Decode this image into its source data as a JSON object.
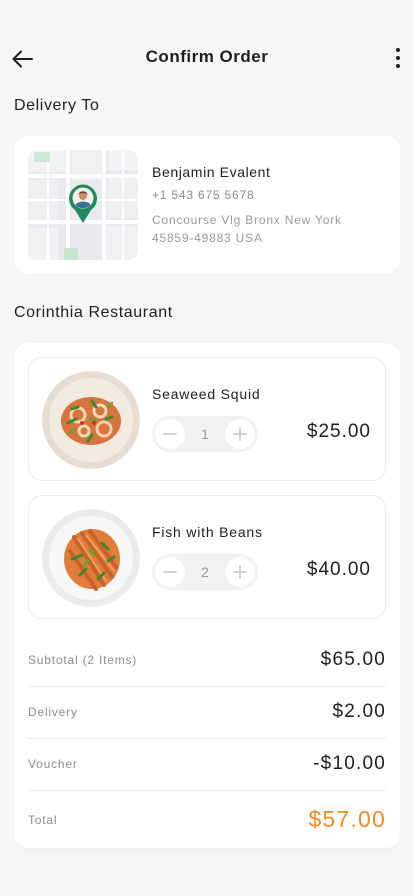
{
  "header": {
    "title": "Confirm Order",
    "back_icon": "arrow-left-icon",
    "more_icon": "more-vertical-icon"
  },
  "delivery": {
    "section_title": "Delivery To",
    "name": "Benjamin Evalent",
    "phone": "+1 543 675 5678",
    "address": "Concourse Vlg Bronx New York 45859-49883 USA"
  },
  "restaurant": {
    "section_title": "Corinthia Restaurant",
    "items": [
      {
        "name": "Seaweed Squid",
        "quantity": "1",
        "price": "$25.00"
      },
      {
        "name": "Fish with Beans",
        "quantity": "2",
        "price": "$40.00"
      }
    ]
  },
  "summary": {
    "subtotal_label": "Subtotal (2 Items)",
    "subtotal_value": "$65.00",
    "delivery_label": "Delivery",
    "delivery_value": "$2.00",
    "voucher_label": "Voucher",
    "voucher_value": "-$10.00",
    "total_label": "Total",
    "total_value": "$57.00"
  },
  "colors": {
    "accent": "#f08a24",
    "map_pin": "#1f8a5b",
    "background": "#f6f6f6"
  }
}
